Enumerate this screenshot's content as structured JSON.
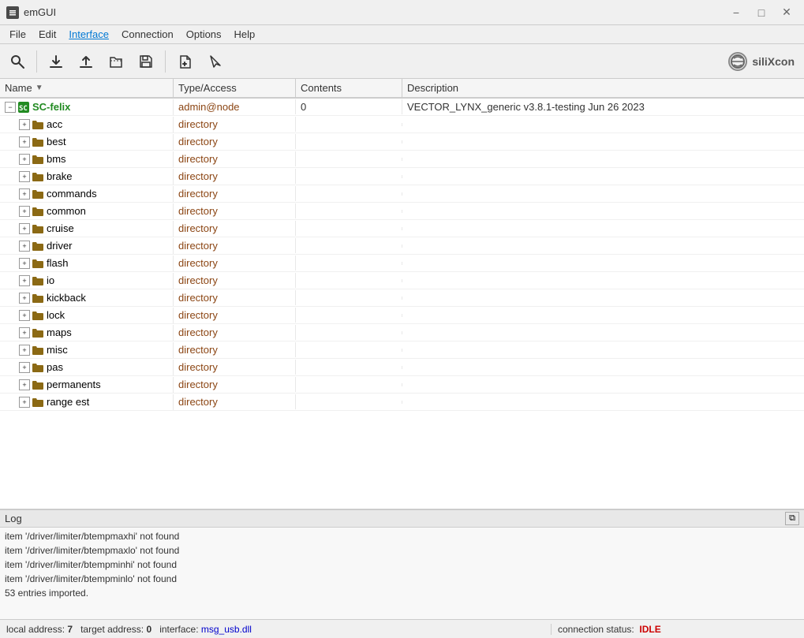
{
  "titleBar": {
    "appIcon": "⬛",
    "title": "emGUI",
    "minimizeLabel": "−",
    "maximizeLabel": "□",
    "closeLabel": "✕"
  },
  "menuBar": {
    "items": [
      {
        "label": "File",
        "active": false
      },
      {
        "label": "Edit",
        "active": false
      },
      {
        "label": "Interface",
        "active": true
      },
      {
        "label": "Connection",
        "active": false
      },
      {
        "label": "Options",
        "active": false
      },
      {
        "label": "Help",
        "active": false
      }
    ]
  },
  "toolbar": {
    "buttons": [
      {
        "name": "search-button",
        "icon": "🔍",
        "tooltip": "Search"
      },
      {
        "name": "download-button",
        "icon": "⬇",
        "tooltip": "Download"
      },
      {
        "name": "upload-button",
        "icon": "⬆",
        "tooltip": "Upload"
      },
      {
        "name": "open-button",
        "icon": "📂",
        "tooltip": "Open"
      },
      {
        "name": "save-button",
        "icon": "💾",
        "tooltip": "Save"
      }
    ],
    "sep1": true,
    "extraButtons": [
      {
        "name": "new-button",
        "icon": "📄",
        "tooltip": "New"
      },
      {
        "name": "pointer-button",
        "icon": "👆",
        "tooltip": "Pointer"
      }
    ],
    "logo": "siliXcon"
  },
  "table": {
    "columns": [
      {
        "id": "name",
        "label": "Name",
        "hasSortArrow": true
      },
      {
        "id": "typeAccess",
        "label": "Type/Access"
      },
      {
        "id": "contents",
        "label": "Contents"
      },
      {
        "id": "description",
        "label": "Description"
      }
    ],
    "rows": [
      {
        "id": "sc-felix",
        "level": 0,
        "expandable": true,
        "expanded": true,
        "isRoot": true,
        "name": "SC-felix",
        "typeAccess": "admin@node",
        "contents": "0",
        "description": "VECTOR_LYNX_generic v3.8.1-testing Jun 26 2023"
      },
      {
        "id": "acc",
        "level": 1,
        "expandable": true,
        "expanded": false,
        "isRoot": false,
        "name": "acc",
        "typeAccess": "directory",
        "contents": "",
        "description": ""
      },
      {
        "id": "best",
        "level": 1,
        "expandable": true,
        "expanded": false,
        "isRoot": false,
        "name": "best",
        "typeAccess": "directory",
        "contents": "",
        "description": ""
      },
      {
        "id": "bms",
        "level": 1,
        "expandable": true,
        "expanded": false,
        "isRoot": false,
        "name": "bms",
        "typeAccess": "directory",
        "contents": "",
        "description": ""
      },
      {
        "id": "brake",
        "level": 1,
        "expandable": true,
        "expanded": false,
        "isRoot": false,
        "name": "brake",
        "typeAccess": "directory",
        "contents": "",
        "description": ""
      },
      {
        "id": "commands",
        "level": 1,
        "expandable": true,
        "expanded": false,
        "isRoot": false,
        "name": "commands",
        "typeAccess": "directory",
        "contents": "",
        "description": ""
      },
      {
        "id": "common",
        "level": 1,
        "expandable": true,
        "expanded": false,
        "isRoot": false,
        "name": "common",
        "typeAccess": "directory",
        "contents": "",
        "description": ""
      },
      {
        "id": "cruise",
        "level": 1,
        "expandable": true,
        "expanded": false,
        "isRoot": false,
        "name": "cruise",
        "typeAccess": "directory",
        "contents": "",
        "description": ""
      },
      {
        "id": "driver",
        "level": 1,
        "expandable": true,
        "expanded": false,
        "isRoot": false,
        "name": "driver",
        "typeAccess": "directory",
        "contents": "",
        "description": ""
      },
      {
        "id": "flash",
        "level": 1,
        "expandable": true,
        "expanded": false,
        "isRoot": false,
        "name": "flash",
        "typeAccess": "directory",
        "contents": "",
        "description": ""
      },
      {
        "id": "io",
        "level": 1,
        "expandable": true,
        "expanded": false,
        "isRoot": false,
        "name": "io",
        "typeAccess": "directory",
        "contents": "",
        "description": ""
      },
      {
        "id": "kickback",
        "level": 1,
        "expandable": true,
        "expanded": false,
        "isRoot": false,
        "name": "kickback",
        "typeAccess": "directory",
        "contents": "",
        "description": ""
      },
      {
        "id": "lock",
        "level": 1,
        "expandable": true,
        "expanded": false,
        "isRoot": false,
        "name": "lock",
        "typeAccess": "directory",
        "contents": "",
        "description": ""
      },
      {
        "id": "maps",
        "level": 1,
        "expandable": true,
        "expanded": false,
        "isRoot": false,
        "name": "maps",
        "typeAccess": "directory",
        "contents": "",
        "description": ""
      },
      {
        "id": "misc",
        "level": 1,
        "expandable": true,
        "expanded": false,
        "isRoot": false,
        "name": "misc",
        "typeAccess": "directory",
        "contents": "",
        "description": ""
      },
      {
        "id": "pas",
        "level": 1,
        "expandable": true,
        "expanded": false,
        "isRoot": false,
        "name": "pas",
        "typeAccess": "directory",
        "contents": "",
        "description": ""
      },
      {
        "id": "permanents",
        "level": 1,
        "expandable": true,
        "expanded": false,
        "isRoot": false,
        "name": "permanents",
        "typeAccess": "directory",
        "contents": "",
        "description": ""
      },
      {
        "id": "range-est",
        "level": 1,
        "expandable": true,
        "expanded": false,
        "isRoot": false,
        "name": "range est",
        "typeAccess": "directory",
        "contents": "",
        "description": ""
      }
    ]
  },
  "log": {
    "title": "Log",
    "lines": [
      "item '/driver/limiter/btempmaxhi' not found",
      "item '/driver/limiter/btempmaxlo' not found",
      "item '/driver/limiter/btempminhi' not found",
      "item '/driver/limiter/btempminlo' not found",
      "53 entries imported."
    ]
  },
  "statusBar": {
    "left": {
      "localAddressLabel": "local address:",
      "localAddress": "7",
      "targetAddressLabel": "target address:",
      "targetAddress": "0",
      "interfaceLabel": "interface:",
      "interface": "msg_usb.dll"
    },
    "right": {
      "label": "connection status:",
      "status": "IDLE"
    }
  }
}
